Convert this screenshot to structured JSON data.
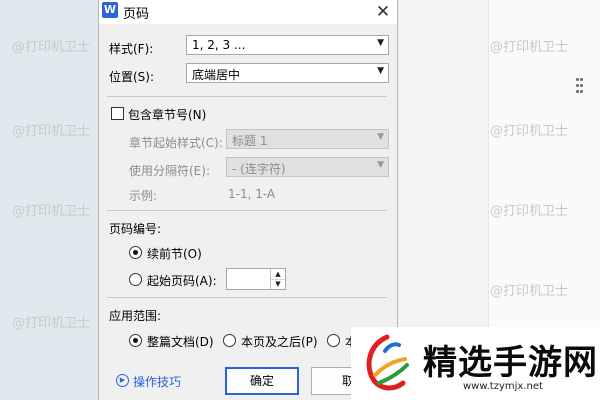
{
  "dialog": {
    "title": "页码",
    "app_icon": "W",
    "style_label": "样式(F):",
    "style_value": "1, 2, 3 ...",
    "position_label": "位置(S):",
    "position_value": "底端居中",
    "include_chapter_label": "包含章节号(N)",
    "chapter_start_style_label": "章节起始样式(C):",
    "chapter_start_style_value": "标题 1",
    "separator_label": "使用分隔符(E):",
    "separator_value": "-    (连字符)",
    "example_label": "示例:",
    "example_value": "1-1, 1-A",
    "numbering_header": "页码编号:",
    "continue_label": "续前节(O)",
    "start_at_label": "起始页码(A):",
    "start_at_value": "",
    "apply_header": "应用范围:",
    "apply_whole_label": "整篇文档(D)",
    "apply_this_label": "本页及之后(P)",
    "apply_partial_label": "本",
    "help_label": "操作技巧",
    "ok_label": "确定",
    "cancel_label": "取"
  },
  "watermark_text": "@打印机卫士",
  "brand": {
    "name": "精选手游网",
    "url": "www.tzymjx.net"
  },
  "colors": {
    "accent": "#2b63d9",
    "dialog_bg": "#f0f0f0",
    "disabled_text": "#8c8c8c"
  },
  "icons": {
    "close": "close-icon",
    "dropdown": "chevron-down-icon",
    "help": "play-circle-icon"
  }
}
